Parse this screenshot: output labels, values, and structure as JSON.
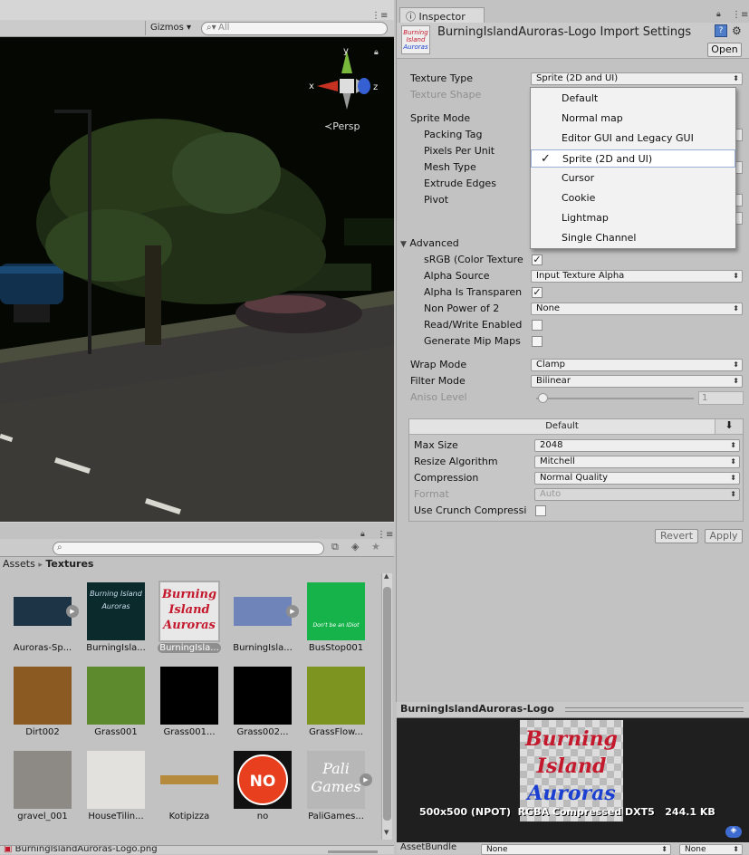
{
  "scene": {
    "gizmos_label": "Gizmos",
    "search_placeholder": "All",
    "gizmo_axes": {
      "y": "y",
      "x": "x",
      "z": "z"
    },
    "persp_label": "Persp"
  },
  "inspector": {
    "tab_label": "Inspector",
    "title": "BurningIslandAuroras-Logo Import Settings",
    "open_button": "Open",
    "thumb_lines": [
      "Burning",
      "Island",
      "Auroras"
    ],
    "fields": {
      "texture_type": {
        "label": "Texture Type",
        "value": "Sprite (2D and UI)"
      },
      "texture_shape": {
        "label": "Texture Shape"
      },
      "sprite_mode": {
        "label": "Sprite Mode"
      },
      "packing_tag": {
        "label": "Packing Tag"
      },
      "pixels_per_unit": {
        "label": "Pixels Per Unit"
      },
      "mesh_type": {
        "label": "Mesh Type"
      },
      "extrude_edges": {
        "label": "Extrude Edges"
      },
      "pivot": {
        "label": "Pivot"
      },
      "advanced": {
        "label": "Advanced"
      },
      "srgb": {
        "label": "sRGB (Color Texture",
        "checked": true
      },
      "alpha_source": {
        "label": "Alpha Source",
        "value": "Input Texture Alpha"
      },
      "alpha_transparency": {
        "label": "Alpha Is Transparen",
        "checked": true
      },
      "non_power_of_2": {
        "label": "Non Power of 2",
        "value": "None"
      },
      "read_write": {
        "label": "Read/Write Enabled",
        "checked": false
      },
      "mip_maps": {
        "label": "Generate Mip Maps",
        "checked": false
      },
      "wrap_mode": {
        "label": "Wrap Mode",
        "value": "Clamp"
      },
      "filter_mode": {
        "label": "Filter Mode",
        "value": "Bilinear"
      },
      "aniso_level": {
        "label": "Aniso Level",
        "value": "1",
        "fraction": 0.0
      }
    },
    "platform": {
      "tab_label": "Default",
      "max_size": {
        "label": "Max Size",
        "value": "2048"
      },
      "resize_algorithm": {
        "label": "Resize Algorithm",
        "value": "Mitchell"
      },
      "compression": {
        "label": "Compression",
        "value": "Normal Quality"
      },
      "format": {
        "label": "Format",
        "value": "Auto"
      },
      "crunch": {
        "label": "Use Crunch Compressi",
        "checked": false
      }
    },
    "revert_button": "Revert",
    "apply_button": "Apply",
    "dropdown_options": [
      {
        "label": "Default",
        "selected": false
      },
      {
        "label": "Normal map",
        "selected": false
      },
      {
        "label": "Editor GUI and Legacy GUI",
        "selected": false
      },
      {
        "label": "Sprite (2D and UI)",
        "selected": true
      },
      {
        "label": "Cursor",
        "selected": false
      },
      {
        "label": "Cookie",
        "selected": false
      },
      {
        "label": "Lightmap",
        "selected": false
      },
      {
        "label": "Single Channel",
        "selected": false
      }
    ],
    "check_glyph": "✓"
  },
  "preview": {
    "title": "BurningIslandAuroras-Logo",
    "logo_lines": [
      "Burning",
      "Island",
      "Auroras"
    ],
    "info": "500x500 (NPOT)  RGBA Compressed DXT5   244.1 KB",
    "asset_bundle_label": "AssetBundle",
    "asset_bundle_value": "None",
    "variant_value": "None"
  },
  "project": {
    "breadcrumb_root": "Assets",
    "breadcrumb_sep": "▸",
    "breadcrumb_current": "Textures",
    "status_path": "BurningIslandAuroras-Logo.png",
    "items": [
      {
        "caption": "Auroras-Sp...",
        "color": "#1d3346"
      },
      {
        "caption": "BurningIsla...",
        "color": "#0a2a2c",
        "text": "Burning Island Auroras"
      },
      {
        "caption": "BurningIsla...",
        "color": "#e8e8e8",
        "text": "Burning Island Auroras",
        "selected": true
      },
      {
        "caption": "BurningIsla...",
        "color": "#6f84b8"
      },
      {
        "caption": "BusStop001",
        "color": "#15b34a",
        "text": "Don't be an IDiot"
      },
      {
        "caption": "Dirt002",
        "color": "#8a5a22"
      },
      {
        "caption": "Grass001",
        "color": "#5d8a2c"
      },
      {
        "caption": "Grass001...",
        "color": "#000000"
      },
      {
        "caption": "Grass002...",
        "color": "#000000"
      },
      {
        "caption": "GrassFlow...",
        "color": "#7d9420"
      },
      {
        "caption": "gravel_001",
        "color": "#8d8a86"
      },
      {
        "caption": "HouseTilin...",
        "color": "#e2e1dd"
      },
      {
        "caption": "Kotipizza",
        "color": "#b68a3d"
      },
      {
        "caption": "no",
        "color": "#e8401e",
        "text": "NO"
      },
      {
        "caption": "PaliGames...",
        "color": "#b7b7b7",
        "text": "Pali Games"
      }
    ]
  },
  "colors": {
    "red": "#c4182d",
    "blue": "#1a3fd1"
  }
}
